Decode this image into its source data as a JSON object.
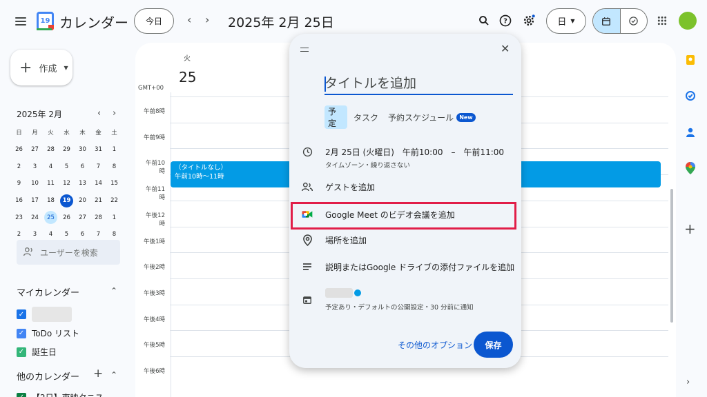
{
  "header": {
    "app_title": "カレンダー",
    "logo_day": "19",
    "today_label": "今日",
    "date_heading": "2025年 2月 25日",
    "view_select": "日"
  },
  "sidebar": {
    "create_label": "作成",
    "mini_month": "2025年 2月",
    "weekdays": [
      "日",
      "月",
      "火",
      "水",
      "木",
      "金",
      "土"
    ],
    "weeks": [
      [
        "26",
        "27",
        "28",
        "29",
        "30",
        "31",
        "1"
      ],
      [
        "2",
        "3",
        "4",
        "5",
        "6",
        "7",
        "8"
      ],
      [
        "9",
        "10",
        "11",
        "12",
        "13",
        "14",
        "15"
      ],
      [
        "16",
        "17",
        "18",
        "19",
        "20",
        "21",
        "22"
      ],
      [
        "23",
        "24",
        "25",
        "26",
        "27",
        "28",
        "1"
      ],
      [
        "2",
        "3",
        "4",
        "5",
        "6",
        "7",
        "8"
      ]
    ],
    "today_date": "19",
    "selected_date": "25",
    "user_search_placeholder": "ユーザーを検索",
    "my_calendars_heading": "マイカレンダー",
    "my_calendars": [
      {
        "label": "",
        "color": "#1a73e8"
      },
      {
        "label": "ToDo リスト",
        "color": "#4285f4"
      },
      {
        "label": "誕生日",
        "color": "#33b679"
      }
    ],
    "other_calendars_heading": "他のカレンダー",
    "other_calendar_partial": "【2日】東映タニス"
  },
  "main": {
    "day_name": "火",
    "day_number": "25",
    "timezone": "GMT+00",
    "hours": [
      "午前8時",
      "午前9時",
      "午前10時",
      "午前11時",
      "午後12時",
      "午後1時",
      "午後2時",
      "午後3時",
      "午後4時",
      "午後5時",
      "午後6時"
    ],
    "event": {
      "title": "（タイトルなし）",
      "time": "午前10時～11時",
      "color": "#039be5"
    }
  },
  "dialog": {
    "title_placeholder": "タイトルを追加",
    "tabs": {
      "event": "予定",
      "task": "タスク",
      "appointment": "予約スケジュール",
      "new_badge": "New"
    },
    "datetime_line": "2月 25日 (火曜日)　午前10:00　–　午前11:00",
    "datetime_sub": "タイムゾーン・繰り返さない",
    "add_guests": "ゲストを追加",
    "add_meet": "Google Meet のビデオ会議を追加",
    "add_location": "場所を追加",
    "add_description": "説明またはGoogle ドライブの添付ファイルを追加",
    "calendar_sub": "予定あり・デフォルトの公開設定・30 分前に通知",
    "more_options": "その他のオプション",
    "save": "保存",
    "highlight_color": "#e11d48"
  }
}
